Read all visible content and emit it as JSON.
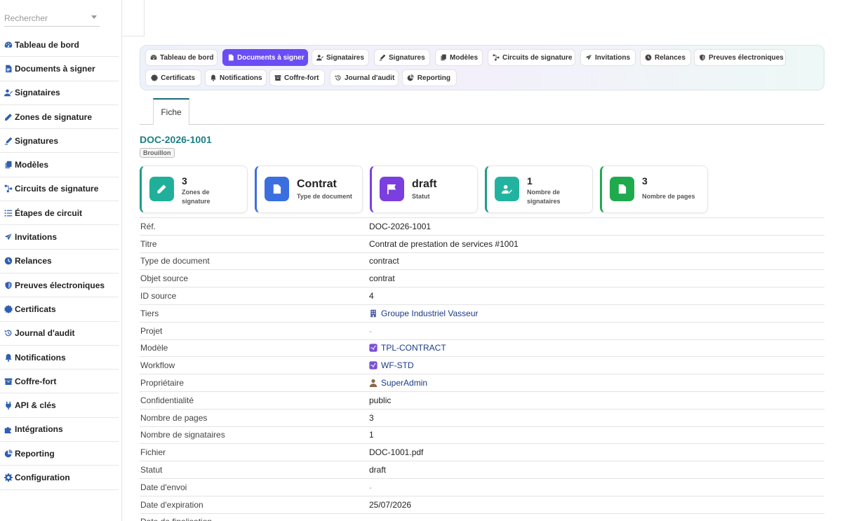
{
  "search": {
    "placeholder": "Rechercher"
  },
  "sidebar": {
    "items": [
      {
        "label": "Tableau de bord",
        "icon": "dashboard-icon"
      },
      {
        "label": "Documents à signer",
        "icon": "file-icon"
      },
      {
        "label": "Signataires",
        "icon": "users-icon"
      },
      {
        "label": "Zones de signature",
        "icon": "pencil-icon"
      },
      {
        "label": "Signatures",
        "icon": "signature-icon"
      },
      {
        "label": "Modèles",
        "icon": "copy-icon"
      },
      {
        "label": "Circuits de signature",
        "icon": "workflow-icon"
      },
      {
        "label": "Étapes de circuit",
        "icon": "list-icon"
      },
      {
        "label": "Invitations",
        "icon": "paper-plane-icon"
      },
      {
        "label": "Relances",
        "icon": "clock-icon"
      },
      {
        "label": "Preuves électroniques",
        "icon": "shield-icon"
      },
      {
        "label": "Certificats",
        "icon": "badge-certificate-icon"
      },
      {
        "label": "Journal d'audit",
        "icon": "history-icon"
      },
      {
        "label": "Notifications",
        "icon": "bell-icon"
      },
      {
        "label": "Coffre-fort",
        "icon": "archive-icon"
      },
      {
        "label": "API & clés",
        "icon": "plug-icon"
      },
      {
        "label": "Intégrations",
        "icon": "puzzle-icon"
      },
      {
        "label": "Reporting",
        "icon": "chart-pie-icon"
      },
      {
        "label": "Configuration",
        "icon": "gear-icon"
      }
    ]
  },
  "tabs": {
    "row1": [
      {
        "label": "Tableau de bord",
        "icon": "dashboard-icon"
      },
      {
        "label": "Documents à signer",
        "icon": "file-icon",
        "active": true
      },
      {
        "label": "Signataires",
        "icon": "users-icon"
      },
      {
        "label": "Signatures",
        "icon": "signature-icon"
      },
      {
        "label": "Modèles",
        "icon": "copy-icon"
      },
      {
        "label": "Circuits de signature",
        "icon": "workflow-icon"
      },
      {
        "label": "Invitations",
        "icon": "paper-plane-icon"
      },
      {
        "label": "Relances",
        "icon": "clock-icon"
      },
      {
        "label": "Preuves électroniques",
        "icon": "shield-icon"
      }
    ],
    "row2": [
      {
        "label": "Certificats",
        "icon": "badge-certificate-icon"
      },
      {
        "label": "Notifications",
        "icon": "bell-icon"
      },
      {
        "label": "Coffre-fort",
        "icon": "archive-icon"
      },
      {
        "label": "Journal d'audit",
        "icon": "history-icon"
      },
      {
        "label": "Reporting",
        "icon": "chart-pie-icon"
      }
    ]
  },
  "subtab": {
    "label": "Fiche"
  },
  "document": {
    "ref": "DOC-2026-1001",
    "status_badge": "Brouillon"
  },
  "cards": [
    {
      "value": "3",
      "label": "Zones de signature",
      "icon": "pencil-icon",
      "color": "#20b09a",
      "border": "#1f9d89"
    },
    {
      "value": "Contrat",
      "label": "Type de document",
      "icon": "file-icon",
      "color": "#3b6fe0",
      "border": "#3b6fe0"
    },
    {
      "value": "draft",
      "label": "Statut",
      "icon": "flag-icon",
      "color": "#7b3fe0",
      "border": "#7b3fe0"
    },
    {
      "value": "1",
      "label": "Nombre de signataires",
      "icon": "user-edit-icon",
      "color": "#22b3a0",
      "border": "#1f9d89"
    },
    {
      "value": "3",
      "label": "Nombre de pages",
      "icon": "file-icon",
      "color": "#1faa4e",
      "border": "#1faa4e"
    }
  ],
  "fields": [
    {
      "key": "Réf.",
      "value": "DOC-2026-1001"
    },
    {
      "key": "Titre",
      "value": "Contrat de prestation de services #1001"
    },
    {
      "key": "Type de document",
      "value": "contract"
    },
    {
      "key": "Objet source",
      "value": "contrat"
    },
    {
      "key": "ID source",
      "value": "4"
    },
    {
      "key": "Tiers",
      "value": "Groupe Industriel Vasseur",
      "link": true,
      "icon": "building-icon"
    },
    {
      "key": "Projet",
      "value": "-",
      "muted": true
    },
    {
      "key": "Modèle",
      "value": "TPL-CONTRACT",
      "link": true,
      "icon": "template-icon"
    },
    {
      "key": "Workflow",
      "value": "WF-STD",
      "link": true,
      "icon": "template-icon"
    },
    {
      "key": "Propriétaire",
      "value": "SuperAdmin",
      "link": true,
      "icon": "user-icon"
    },
    {
      "key": "Confidentialité",
      "value": "public"
    },
    {
      "key": "Nombre de pages",
      "value": "3"
    },
    {
      "key": "Nombre de signataires",
      "value": "1"
    },
    {
      "key": "Fichier",
      "value": "DOC-1001.pdf"
    },
    {
      "key": "Statut",
      "value": "draft"
    },
    {
      "key": "Date d'envoi",
      "value": "-",
      "muted": true
    },
    {
      "key": "Date d'expiration",
      "value": "25/07/2026"
    },
    {
      "key": "Date de finalisation",
      "value": ""
    }
  ],
  "colors": {
    "accent": "#6a4df4",
    "title": "#1b7f87",
    "link": "#1a3a8a"
  }
}
